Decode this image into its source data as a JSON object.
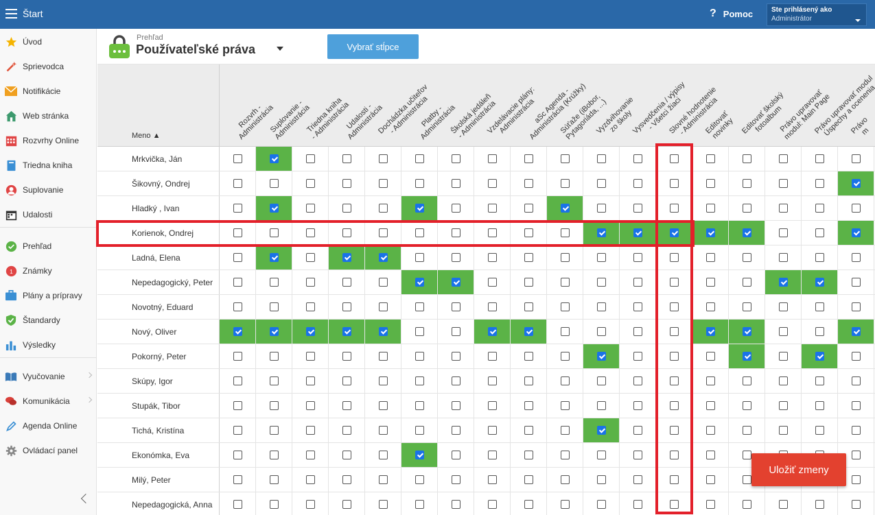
{
  "topbar": {
    "title": "Štart",
    "help": "Pomoc",
    "user_line1": "Ste prihlásený ako",
    "user_line2": "Administrátor"
  },
  "sidebar": {
    "items": [
      {
        "label": "Úvod",
        "icon": "star-icon"
      },
      {
        "label": "Sprievodca",
        "icon": "wand-icon"
      },
      {
        "label": "Notifikácie",
        "icon": "envelope-icon"
      },
      {
        "label": "Web stránka",
        "icon": "house-icon"
      },
      {
        "label": "Rozvrhy Online",
        "icon": "calendar-grid-icon"
      },
      {
        "label": "Triedna kniha",
        "icon": "book-icon"
      },
      {
        "label": "Suplovanie",
        "icon": "person-icon"
      },
      {
        "label": "Udalosti",
        "icon": "calendar-icon"
      },
      {
        "label": "Prehľad",
        "icon": "check-circle-icon"
      },
      {
        "label": "Známky",
        "icon": "grade-icon"
      },
      {
        "label": "Plány a prípravy",
        "icon": "briefcase-icon"
      },
      {
        "label": "Štandardy",
        "icon": "shield-icon"
      },
      {
        "label": "Výsledky",
        "icon": "bar-chart-icon"
      },
      {
        "label": "Vyučovanie",
        "icon": "open-book-icon"
      },
      {
        "label": "Komunikácia",
        "icon": "chat-icon"
      },
      {
        "label": "Agenda Online",
        "icon": "pen-icon"
      },
      {
        "label": "Ovládací panel",
        "icon": "gear-icon"
      }
    ]
  },
  "header": {
    "breadcrumb": "Prehľad",
    "title": "Používateľské práva",
    "select_columns": "Vybrať stĺpce"
  },
  "table": {
    "name_header": "Meno ▲",
    "columns": [
      [
        "Rozvrh -",
        "Administrácia"
      ],
      [
        "Suplovanie -",
        "Administrácia"
      ],
      [
        "Triedna kniha",
        "- Administrácia"
      ],
      [
        "Udalosti -",
        "Administrácia"
      ],
      [
        "Dochádzka učiteľov",
        "- Administrácia"
      ],
      [
        "Platby -",
        "Administrácia"
      ],
      [
        "Školská jedáleň",
        "- Administrácia"
      ],
      [
        "Vzdelávacie plány:",
        "Administrácia"
      ],
      [
        "aSc Agenda -",
        "Administrácia (Krúžky)"
      ],
      [
        "Súťaže (iBobor,",
        "Pytagoriáda, ...)"
      ],
      [
        "Vyzdvihovanie",
        "zo školy"
      ],
      [
        "Vysvedčenia / výpisy",
        "- Všetci žiaci"
      ],
      [
        "Slovné hodnotenie",
        "- Administrácia"
      ],
      [
        "Editovať",
        "novinky"
      ],
      [
        "Editovať školský",
        "fotoalbum"
      ],
      [
        "Právo upravovať",
        "modul: Main Page"
      ],
      [
        "Právo upravovať modul",
        "Úspechy a ocenenia"
      ],
      [
        "Právo",
        "m"
      ]
    ],
    "rows": [
      {
        "name": "Mrkvička, Ján",
        "checks": [
          0,
          1,
          0,
          0,
          0,
          0,
          0,
          0,
          0,
          0,
          0,
          0,
          0,
          0,
          0,
          0,
          0,
          0
        ]
      },
      {
        "name": "Šikovný, Ondrej",
        "checks": [
          0,
          0,
          0,
          0,
          0,
          0,
          0,
          0,
          0,
          0,
          0,
          0,
          0,
          0,
          0,
          0,
          0,
          1
        ]
      },
      {
        "name": "Hladký , Ivan",
        "checks": [
          0,
          1,
          0,
          0,
          0,
          1,
          0,
          0,
          0,
          1,
          0,
          0,
          0,
          0,
          0,
          0,
          0,
          0
        ]
      },
      {
        "name": "Korienok, Ondrej",
        "checks": [
          0,
          0,
          0,
          0,
          0,
          0,
          0,
          0,
          0,
          0,
          1,
          1,
          1,
          1,
          1,
          0,
          0,
          1
        ]
      },
      {
        "name": "Ladná, Elena",
        "checks": [
          0,
          1,
          0,
          1,
          1,
          0,
          0,
          0,
          0,
          0,
          0,
          0,
          0,
          0,
          0,
          0,
          0,
          0
        ]
      },
      {
        "name": "Nepedagogický, Peter",
        "checks": [
          0,
          0,
          0,
          0,
          0,
          1,
          1,
          0,
          0,
          0,
          0,
          0,
          0,
          0,
          0,
          1,
          1,
          0
        ]
      },
      {
        "name": "Novotný, Eduard",
        "checks": [
          0,
          0,
          0,
          0,
          0,
          0,
          0,
          0,
          0,
          0,
          0,
          0,
          0,
          0,
          0,
          0,
          0,
          0
        ]
      },
      {
        "name": "Nový, Oliver",
        "checks": [
          1,
          1,
          1,
          1,
          1,
          0,
          0,
          1,
          1,
          0,
          0,
          0,
          0,
          1,
          1,
          0,
          0,
          1
        ]
      },
      {
        "name": "Pokorný, Peter",
        "checks": [
          0,
          0,
          0,
          0,
          0,
          0,
          0,
          0,
          0,
          0,
          1,
          0,
          0,
          0,
          1,
          0,
          1,
          0
        ]
      },
      {
        "name": "Skúpy, Igor",
        "checks": [
          0,
          0,
          0,
          0,
          0,
          0,
          0,
          0,
          0,
          0,
          0,
          0,
          0,
          0,
          0,
          0,
          0,
          0
        ]
      },
      {
        "name": "Stupák, Tibor",
        "checks": [
          0,
          0,
          0,
          0,
          0,
          0,
          0,
          0,
          0,
          0,
          0,
          0,
          0,
          0,
          0,
          0,
          0,
          0
        ]
      },
      {
        "name": "Tichá, Kristína",
        "checks": [
          0,
          0,
          0,
          0,
          0,
          0,
          0,
          0,
          0,
          0,
          1,
          0,
          0,
          0,
          0,
          0,
          0,
          0
        ]
      },
      {
        "name": "Ekonómka, Eva",
        "checks": [
          0,
          0,
          0,
          0,
          0,
          1,
          0,
          0,
          0,
          0,
          0,
          0,
          0,
          0,
          0,
          0,
          0,
          0
        ]
      },
      {
        "name": "Milý, Peter",
        "checks": [
          0,
          0,
          0,
          0,
          0,
          0,
          0,
          0,
          0,
          0,
          0,
          0,
          0,
          0,
          0,
          0,
          0,
          0
        ]
      },
      {
        "name": "Nepedagogická, Anna",
        "checks": [
          0,
          0,
          0,
          0,
          0,
          0,
          0,
          0,
          0,
          0,
          0,
          0,
          0,
          0,
          0,
          0,
          0,
          0
        ]
      }
    ]
  },
  "save_button": "Uložiť zmeny",
  "colors": {
    "topbar": "#2a68a8",
    "checked_cell": "#5bb347",
    "highlight": "#e3202a",
    "save": "#e3412f",
    "select_btn": "#4ea0db"
  }
}
